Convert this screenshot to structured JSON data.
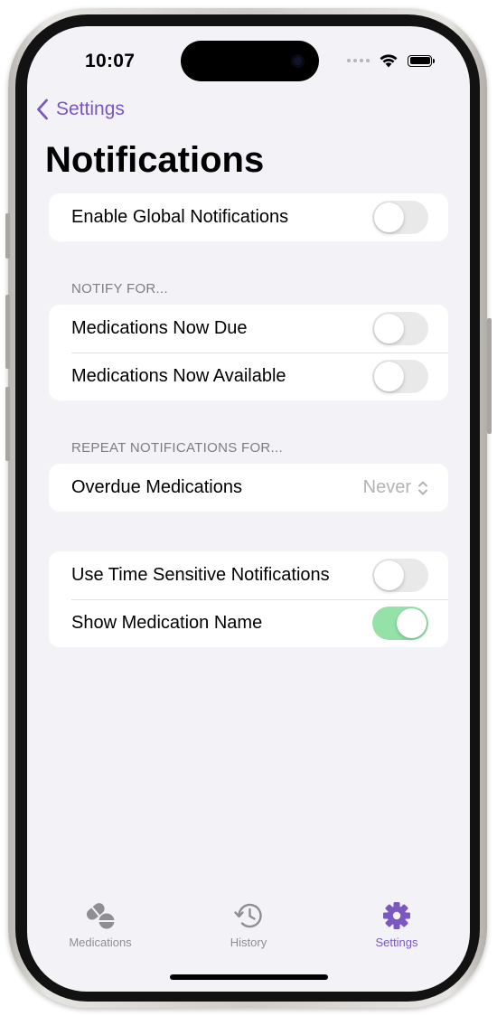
{
  "status_bar": {
    "time": "10:07"
  },
  "nav": {
    "back_label": "Settings",
    "title": "Notifications"
  },
  "global": {
    "label": "Enable Global Notifications",
    "on": false
  },
  "notify_for": {
    "header": "NOTIFY FOR...",
    "items": [
      {
        "label": "Medications Now Due",
        "on": false
      },
      {
        "label": "Medications Now Available",
        "on": false
      }
    ]
  },
  "repeat": {
    "header": "REPEAT NOTIFICATIONS FOR...",
    "label": "Overdue Medications",
    "value": "Never"
  },
  "options": {
    "items": [
      {
        "label": "Use Time Sensitive Notifications",
        "on": false
      },
      {
        "label": "Show Medication Name",
        "on": true
      }
    ]
  },
  "tabs": [
    {
      "label": "Medications",
      "icon": "pills-icon",
      "active": false
    },
    {
      "label": "History",
      "icon": "history-clock-icon",
      "active": false
    },
    {
      "label": "Settings",
      "icon": "gear-icon",
      "active": true
    }
  ],
  "colors": {
    "accent": "#7b57c1",
    "toggle_on": "#94e2a8",
    "toggle_off": "#e9e9ea",
    "background": "#f2f2f7"
  }
}
